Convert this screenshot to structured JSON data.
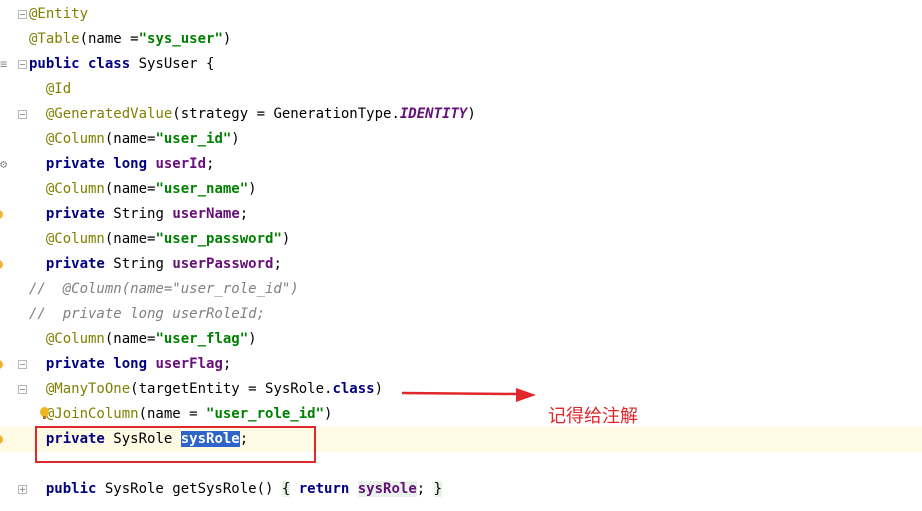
{
  "editor": {
    "lines": [
      {
        "id": "l1",
        "parts": [
          {
            "t": "@Entity",
            "c": "ann"
          }
        ]
      },
      {
        "id": "l2",
        "parts": [
          {
            "t": "@Table",
            "c": "ann"
          },
          {
            "t": "(name =",
            "c": ""
          },
          {
            "t": "\"sys_user\"",
            "c": "str"
          },
          {
            "t": ")",
            "c": ""
          }
        ]
      },
      {
        "id": "l3",
        "parts": [
          {
            "t": "public class ",
            "c": "kw"
          },
          {
            "t": "SysUser {",
            "c": ""
          }
        ]
      },
      {
        "id": "l4",
        "parts": [
          {
            "t": "  @Id",
            "c": "ann"
          }
        ]
      },
      {
        "id": "l5",
        "parts": [
          {
            "t": "  @GeneratedValue",
            "c": "ann"
          },
          {
            "t": "(strategy = GenerationType.",
            "c": ""
          },
          {
            "t": "IDENTITY",
            "c": "cnst"
          },
          {
            "t": ")",
            "c": ""
          }
        ]
      },
      {
        "id": "l6",
        "parts": [
          {
            "t": "  @Column",
            "c": "ann"
          },
          {
            "t": "(name=",
            "c": ""
          },
          {
            "t": "\"user_id\"",
            "c": "str"
          },
          {
            "t": ")",
            "c": ""
          }
        ]
      },
      {
        "id": "l7",
        "parts": [
          {
            "t": "  private long ",
            "c": "kw"
          },
          {
            "t": "userId",
            "c": "fld"
          },
          {
            "t": ";",
            "c": ""
          }
        ]
      },
      {
        "id": "l8",
        "parts": [
          {
            "t": "  @Column",
            "c": "ann"
          },
          {
            "t": "(name=",
            "c": ""
          },
          {
            "t": "\"user_name\"",
            "c": "str"
          },
          {
            "t": ")",
            "c": ""
          }
        ]
      },
      {
        "id": "l9",
        "parts": [
          {
            "t": "  private ",
            "c": "kw"
          },
          {
            "t": "String ",
            "c": ""
          },
          {
            "t": "userName",
            "c": "fld"
          },
          {
            "t": ";",
            "c": ""
          }
        ]
      },
      {
        "id": "l10",
        "parts": [
          {
            "t": "  @Column",
            "c": "ann"
          },
          {
            "t": "(name=",
            "c": ""
          },
          {
            "t": "\"user_password\"",
            "c": "str"
          },
          {
            "t": ")",
            "c": ""
          }
        ]
      },
      {
        "id": "l11",
        "parts": [
          {
            "t": "  private ",
            "c": "kw"
          },
          {
            "t": "String ",
            "c": ""
          },
          {
            "t": "userPassword",
            "c": "fld"
          },
          {
            "t": ";",
            "c": ""
          }
        ]
      },
      {
        "id": "l12",
        "parts": [
          {
            "t": "//  @Column(name=\"user_role_id\")",
            "c": "cmt"
          }
        ]
      },
      {
        "id": "l13",
        "parts": [
          {
            "t": "//  private long userRoleId;",
            "c": "cmt"
          }
        ]
      },
      {
        "id": "l14",
        "parts": [
          {
            "t": "  @Column",
            "c": "ann"
          },
          {
            "t": "(name=",
            "c": ""
          },
          {
            "t": "\"user_flag\"",
            "c": "str"
          },
          {
            "t": ")",
            "c": ""
          }
        ]
      },
      {
        "id": "l15",
        "parts": [
          {
            "t": "  private long ",
            "c": "kw"
          },
          {
            "t": "userFlag",
            "c": "fld"
          },
          {
            "t": ";",
            "c": ""
          }
        ]
      },
      {
        "id": "l16",
        "parts": [
          {
            "t": "  @ManyToOne",
            "c": "ann"
          },
          {
            "t": "(targetEntity = SysRole.",
            "c": ""
          },
          {
            "t": "class",
            "c": "kw"
          },
          {
            "t": ")",
            "c": ""
          }
        ]
      },
      {
        "id": "l17",
        "parts": [
          {
            "t": "  @JoinColumn",
            "c": "ann"
          },
          {
            "t": "(name = ",
            "c": ""
          },
          {
            "t": "\"user_role_id\"",
            "c": "str"
          },
          {
            "t": ")",
            "c": ""
          }
        ]
      },
      {
        "id": "l18",
        "parts": [
          {
            "t": "  private ",
            "c": "kw"
          },
          {
            "t": "SysRole ",
            "c": ""
          },
          {
            "t": "sysRole",
            "c": "fld hl"
          },
          {
            "t": ";",
            "c": ""
          }
        ]
      },
      {
        "id": "l19",
        "parts": []
      },
      {
        "id": "l20",
        "parts": [
          {
            "t": "  public ",
            "c": "kw"
          },
          {
            "t": "SysRole getSysRole() ",
            "c": ""
          },
          {
            "t": "{",
            "c": "brace"
          },
          {
            "t": " return ",
            "c": "kw"
          },
          {
            "t": "sysRole",
            "c": "fld brace"
          },
          {
            "t": "; ",
            "c": ""
          },
          {
            "t": "}",
            "c": "brace"
          }
        ]
      }
    ]
  },
  "annotation": {
    "note": "记得给注解",
    "color": "#e0272c"
  }
}
